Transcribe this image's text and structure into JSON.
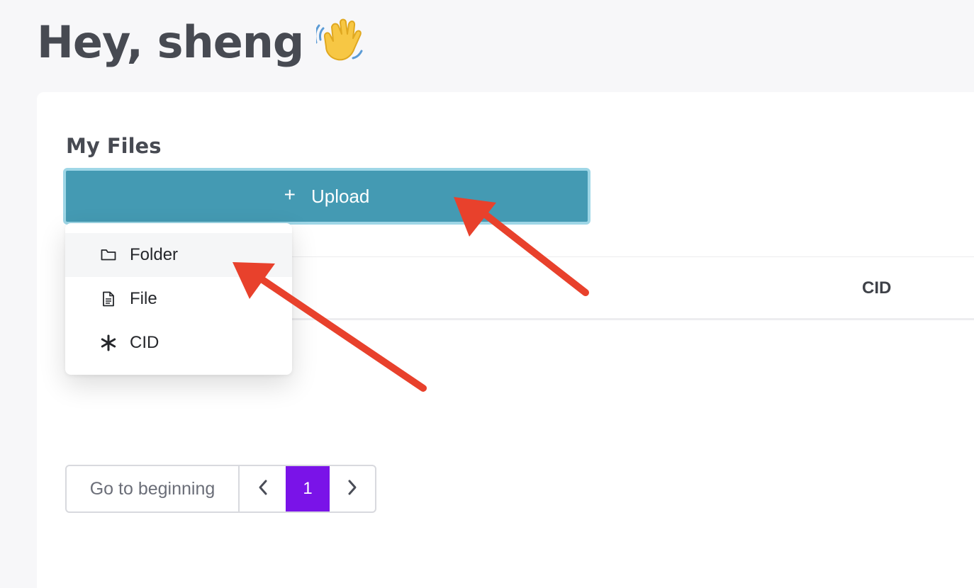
{
  "header": {
    "greeting": "Hey, sheng",
    "wave_emoji": "waving-hand-icon"
  },
  "files": {
    "title": "My Files",
    "upload_label": "Upload",
    "upload_color": "#449ab3",
    "table": {
      "columns": [
        "CID"
      ]
    }
  },
  "upload_menu": {
    "items": [
      {
        "label": "Folder",
        "icon": "folder-icon"
      },
      {
        "label": "File",
        "icon": "file-icon"
      },
      {
        "label": "CID",
        "icon": "asterisk-icon"
      }
    ]
  },
  "pagination": {
    "first_label": "Go to beginning",
    "current_page": "1",
    "accent": "#7a13e8"
  },
  "annotations": {
    "arrow_color": "#e8412c"
  }
}
